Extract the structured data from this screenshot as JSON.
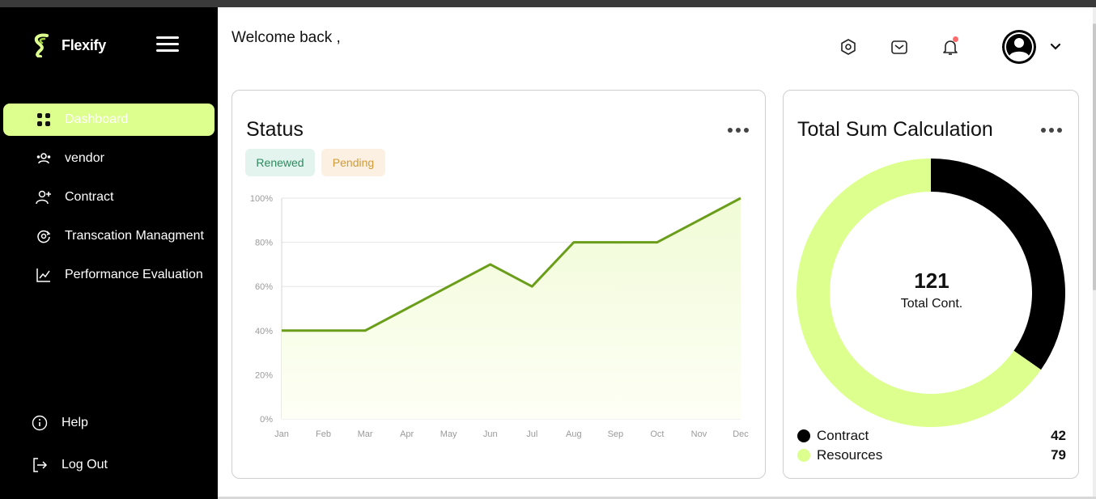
{
  "app": {
    "name": "Flexify"
  },
  "sidebar": {
    "items": [
      {
        "label": "Dashboard",
        "icon": "grid-icon",
        "active": true
      },
      {
        "label": "vendor",
        "icon": "users-icon",
        "active": false
      },
      {
        "label": "Contract",
        "icon": "user-plus-icon",
        "active": false
      },
      {
        "label": "Transcation Managment",
        "icon": "transaction-icon",
        "active": false
      },
      {
        "label": "Performance Evaluation",
        "icon": "chart-line-icon",
        "active": false
      }
    ],
    "bottom": [
      {
        "label": "Help",
        "icon": "info-icon"
      },
      {
        "label": "Log Out",
        "icon": "logout-icon"
      }
    ]
  },
  "header": {
    "welcome": "Welcome back ,",
    "icons": [
      "settings-icon",
      "mail-icon",
      "bell-icon",
      "avatar",
      "chevron-down-icon"
    ]
  },
  "status_card": {
    "title": "Status",
    "chips": {
      "renewed": "Renewed",
      "pending": "Pending"
    }
  },
  "total_card": {
    "title": "Total Sum Calculation",
    "center_value": "121",
    "center_label": "Total Cont.",
    "legend": [
      {
        "label": "Contract",
        "value": "42",
        "color": "#000000"
      },
      {
        "label": "Resources",
        "value": "79",
        "color": "#dcff8d"
      }
    ]
  },
  "colors": {
    "accent": "#dcff8d",
    "line": "#6a9e1a",
    "area": "#f0fbd6",
    "sidebar_bg": "#000000"
  },
  "chart_data": [
    {
      "type": "area",
      "categories": [
        "Jan",
        "Feb",
        "Mar",
        "Apr",
        "May",
        "Jun",
        "Jul",
        "Aug",
        "Sep",
        "Oct",
        "Nov",
        "Dec"
      ],
      "values": [
        40,
        40,
        40,
        50,
        60,
        70,
        60,
        80,
        80,
        80,
        90,
        100
      ],
      "y_ticks": [
        "0%",
        "20%",
        "40%",
        "60%",
        "80%",
        "100%"
      ],
      "ylim": [
        0,
        100
      ],
      "grid": true
    },
    {
      "type": "pie",
      "categories": [
        "Contract",
        "Resources"
      ],
      "values": [
        42,
        79
      ],
      "colors": [
        "#000000",
        "#dcff8d"
      ]
    }
  ]
}
